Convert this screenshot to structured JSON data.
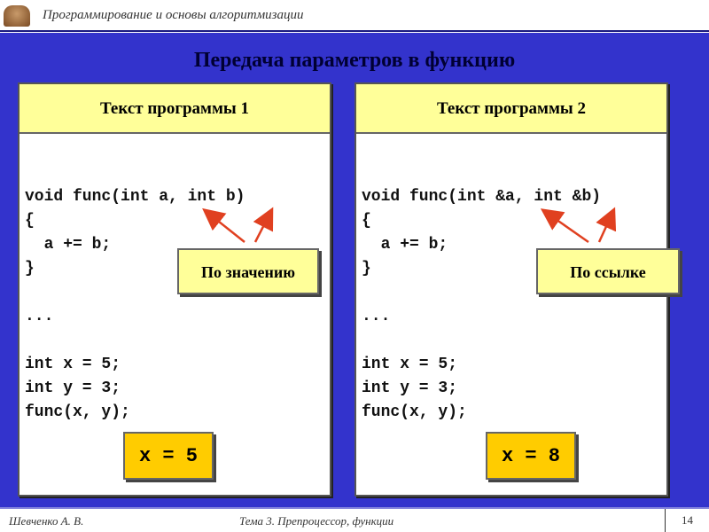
{
  "header": {
    "title": "Программирование и основы алгоритмизации",
    "logo_icon": "book-stack-icon"
  },
  "slide": {
    "title": "Передача параметров в функцию"
  },
  "panels": [
    {
      "heading": "Текст программы 1",
      "code": "void func(int a, int b)\n{\n  a += b;\n}\n\n...\n\nint x = 5;\nint y = 3;\nfunc(x, y);",
      "callout": "По значению",
      "result": "x = 5"
    },
    {
      "heading": "Текст программы 2",
      "code": "void func(int &a, int &b)\n{\n  a += b;\n}\n\n...\n\nint x = 5;\nint y = 3;\nfunc(x, y);",
      "callout": "По ссылке",
      "result": "x = 8"
    }
  ],
  "footer": {
    "author": "Шевченко А. В.",
    "topic": "Тема 3. Препроцессор, функции",
    "page": "14"
  },
  "colors": {
    "background": "#3333cc",
    "panel_header": "#ffff99",
    "result": "#ffcc00",
    "arrow": "#e04020"
  }
}
